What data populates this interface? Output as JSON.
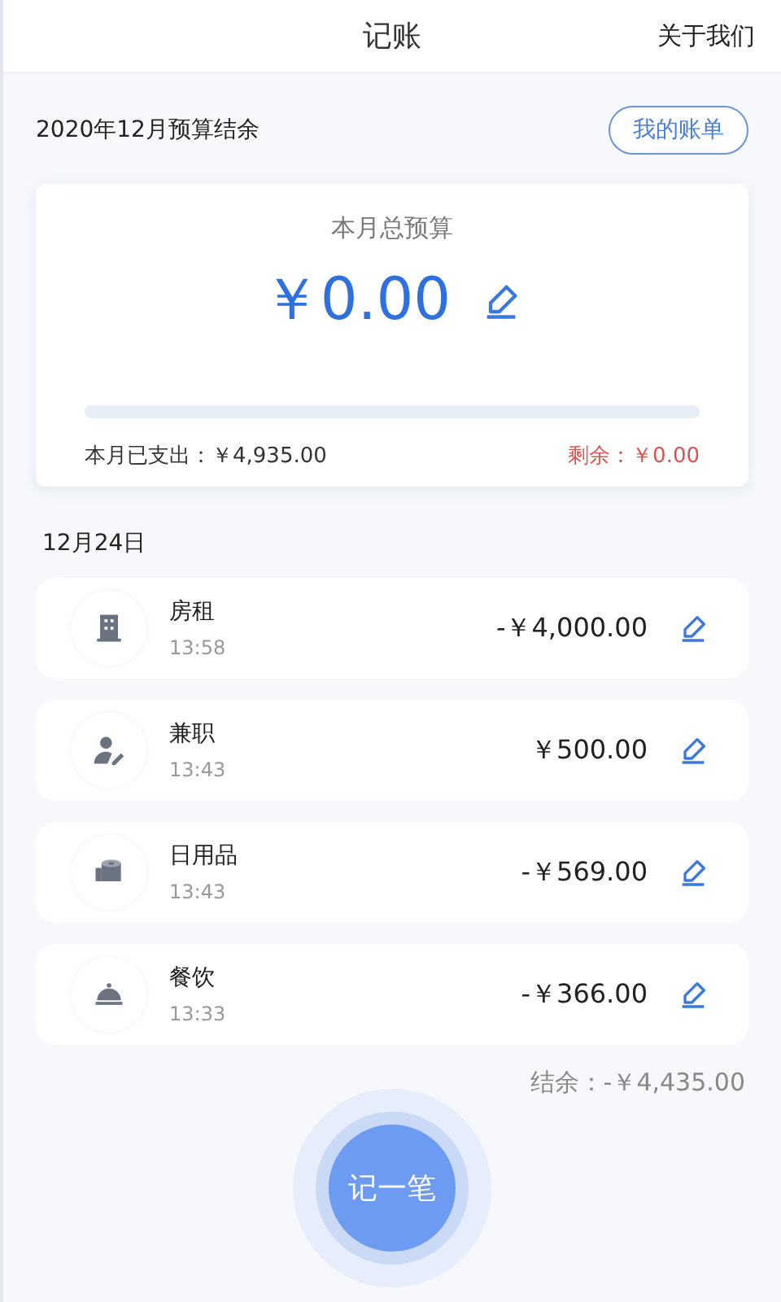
{
  "header": {
    "title": "记账",
    "link": "关于我们"
  },
  "summary": {
    "title": "2020年12月预算结余",
    "bills_button": "我的账单"
  },
  "budget": {
    "label": "本月总预算",
    "amount": "￥0.00",
    "level": 0,
    "spent": "本月已支出：￥4,935.00",
    "remaining": "剩余：￥0.00"
  },
  "day": {
    "date": "12月24日",
    "entries": [
      {
        "kind": "rent",
        "name": "房租",
        "time": "13:58",
        "amount": "-￥4,000.00"
      },
      {
        "kind": "job",
        "name": "兼职",
        "time": "13:43",
        "amount": "￥500.00"
      },
      {
        "kind": "goods",
        "name": "日用品",
        "time": "13:43",
        "amount": "-￥569.00"
      },
      {
        "kind": "food",
        "name": "餐饮",
        "time": "13:33",
        "amount": "-￥366.00"
      }
    ],
    "balance": "结余：-￥4,435.00"
  },
  "add_button": "记一笔"
}
